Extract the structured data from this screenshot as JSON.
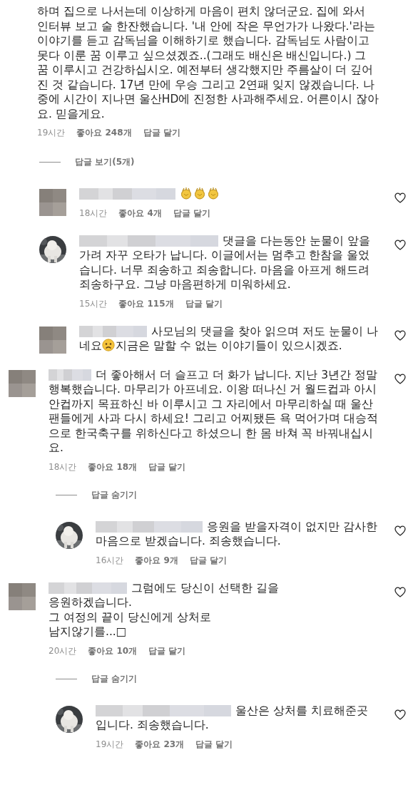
{
  "comments": [
    {
      "parts": [
        {
          "kind": "text",
          "text": "하며 집으로 나서는데 이상하게 마음이 편치 않더군요. 집에 와서 인터뷰 보고 술 한잔했습니다. '내 안에 작은 무언가가 나왔다.'라는 이야기를 듣고 감독님을 이해하기로 했습니다. 감독님도 사람이고 못다 이룬 꿈 이루고 싶으셨겠죠..(그래도 배신은 배신입니다.) 그 꿈 이루시고 건강하십시오. 예전부터 생각했지만 주름살이 더 깊어진 것 같습니다. 17년 만에 우승 그리고 2연패 잊지 않겠습니다. 나중에 시간이 지나면 울산HD에 진정한 사과해주세요. 어른이시 잖아요. 믿을게요."
        }
      ],
      "time": "19시간",
      "likes": "좋아요 248개",
      "reply": "답글 달기",
      "toggle": "답글 보기(5개)",
      "replies": [
        {
          "avatar": {
            "kind": "mosaic"
          },
          "parts": [
            {
              "kind": "clap"
            },
            {
              "kind": "clap"
            },
            {
              "kind": "clap"
            }
          ],
          "time": "18시간",
          "likes": "좋아요 4개",
          "reply": "답글 달기",
          "liked": false
        },
        {
          "parts": [
            {
              "kind": "text",
              "text": "댓글을 다는동안 눈물이 앞을가려 자꾸 오타가 납니다. 이글에서는 멈추고 한참을 울었습니다. 너무 죄송하고 죄송합니다. 마음을 아프게 해드려 죄송하구요. 그냥 마음편하게 미워하세요."
            }
          ],
          "time": "15시간",
          "likes": "좋아요 115개",
          "reply": "답글 달기",
          "liked": false
        },
        {
          "avatar": {
            "kind": "mosaic"
          },
          "parts": [
            {
              "kind": "text",
              "text": "사모님의 댓글을 찾아 읽으며 저도 눈물이 나네요"
            },
            {
              "kind": "sad-face"
            },
            {
              "kind": "text",
              "text": "지금은 말할 수 없는 이야기들이 있으시겠죠."
            }
          ],
          "liked": false
        }
      ]
    },
    {
      "avatar": {
        "kind": "mosaic"
      },
      "parts": [
        {
          "kind": "text",
          "text": "더 좋아해서 더 슬프고 더 화가 납니다. 지난 3년간 정말 행복했습니다. 마무리가 아프네요. 이왕 떠나신 거 월드컵과 아시안컵까지 목표하신 바 이루시고 그 자리에서 마무리하실 때 울산팬들에게 사과 다시 하세요! 그리고 어찌됐든 욕 먹어가며 대승적으로 한국축구를 위하신다고 하셨으니 한 몸 바쳐 꼭 바꿔내십시요."
        }
      ],
      "time": "18시간",
      "likes": "좋아요 18개",
      "reply": "답글 달기",
      "liked": false,
      "toggle": "답글 숨기기",
      "replies": [
        {
          "parts": [
            {
              "kind": "text",
              "text": "응원을 받을자격이 없지만 감사한 마음으로 받겠습니다. 죄송했습니다."
            }
          ],
          "time": "16시간",
          "likes": "좋아요 9개",
          "reply": "답글 달기",
          "liked": false
        }
      ]
    },
    {
      "avatar": {
        "kind": "mosaic"
      },
      "parts": [
        {
          "kind": "text",
          "text": "그럼에도 당신이 선택한 길을\n응원하겠습니다.\n그 여정의 끝이 당신에게 상처로\n남지않기를...□"
        }
      ],
      "time": "20시간",
      "likes": "좋아요 10개",
      "reply": "답글 달기",
      "liked": false,
      "toggle": "답글 숨기기",
      "replies": [
        {
          "parts": [
            {
              "kind": "text",
              "text": "울산은 상처를 치료해준곳\n입니다. 죄송했습니다."
            }
          ],
          "time": "19시간",
          "likes": "좋아요 23개",
          "reply": "답글 달기",
          "liked": false
        }
      ]
    }
  ]
}
